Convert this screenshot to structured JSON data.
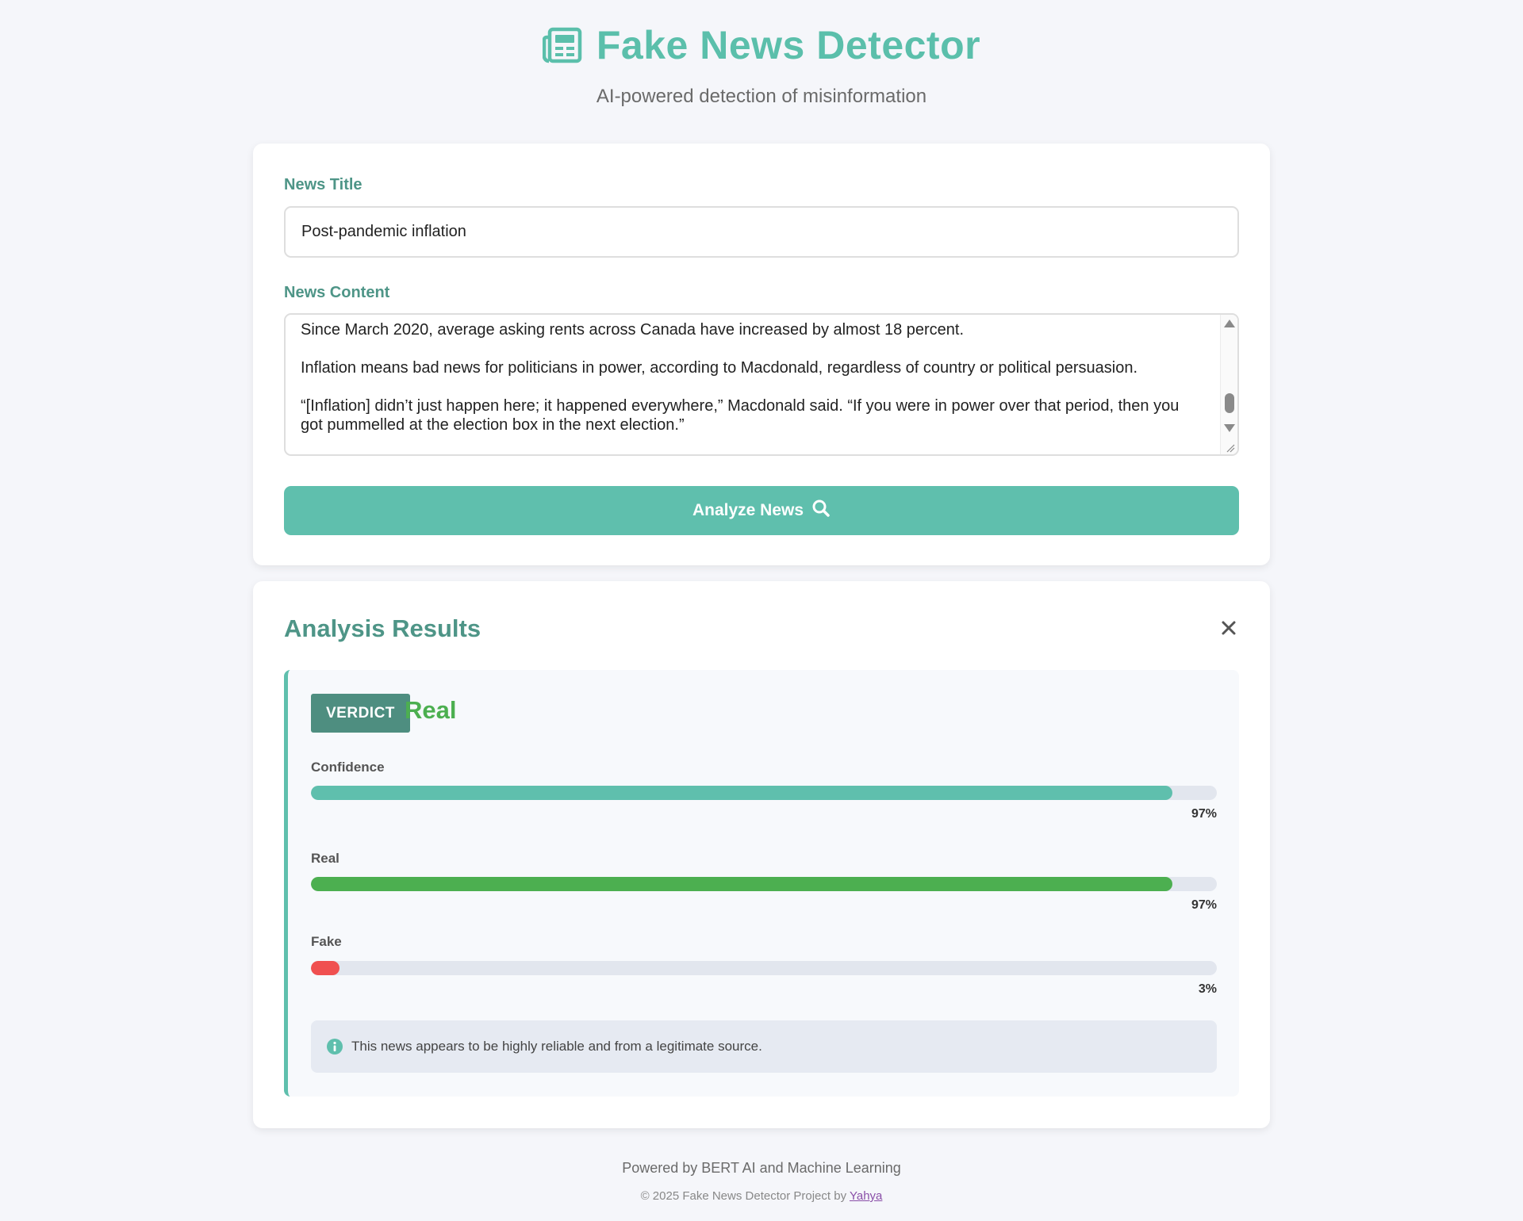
{
  "header": {
    "title": "Fake News Detector",
    "subtitle": "AI-powered detection of misinformation",
    "icon": "newspaper-icon"
  },
  "form": {
    "title_label": "News Title",
    "title_value": "Post-pandemic inflation",
    "content_label": "News Content",
    "content_value": "Since March 2020, average asking rents across Canada have increased by almost 18 percent.\n\nInflation means bad news for politicians in power, according to Macdonald, regardless of country or political persuasion.\n\n“[Inflation] didn’t just happen here; it happened everywhere,” Macdonald said. “If you were in power over that period, then you got pummelled at the election box in the next election.”",
    "analyze_label": "Analyze News",
    "analyze_icon": "search-icon"
  },
  "results": {
    "title": "Analysis Results",
    "close_icon": "close-icon",
    "verdict_badge": "VERDICT",
    "verdict_value": "Real",
    "metrics": [
      {
        "label": "Confidence",
        "percent_text": "97%",
        "fraction": 0.97,
        "color": "#5fbfad"
      },
      {
        "label": "Real",
        "percent_text": "97%",
        "fraction": 0.97,
        "color": "#4caf50"
      },
      {
        "label": "Fake",
        "percent_text": "3%",
        "fraction": 0.03,
        "color": "#f05050"
      }
    ],
    "info_icon": "info-icon",
    "info_text": "This news appears to be highly reliable and from a legitimate source."
  },
  "footer": {
    "line1": "Powered by BERT AI and Machine Learning",
    "line2_prefix": "© 2025 Fake News Detector Project by ",
    "author_link": "Yahya"
  },
  "colors": {
    "accent": "#5fbfad",
    "heading": "#4e9587",
    "real": "#4caf50",
    "fake": "#f05050"
  }
}
